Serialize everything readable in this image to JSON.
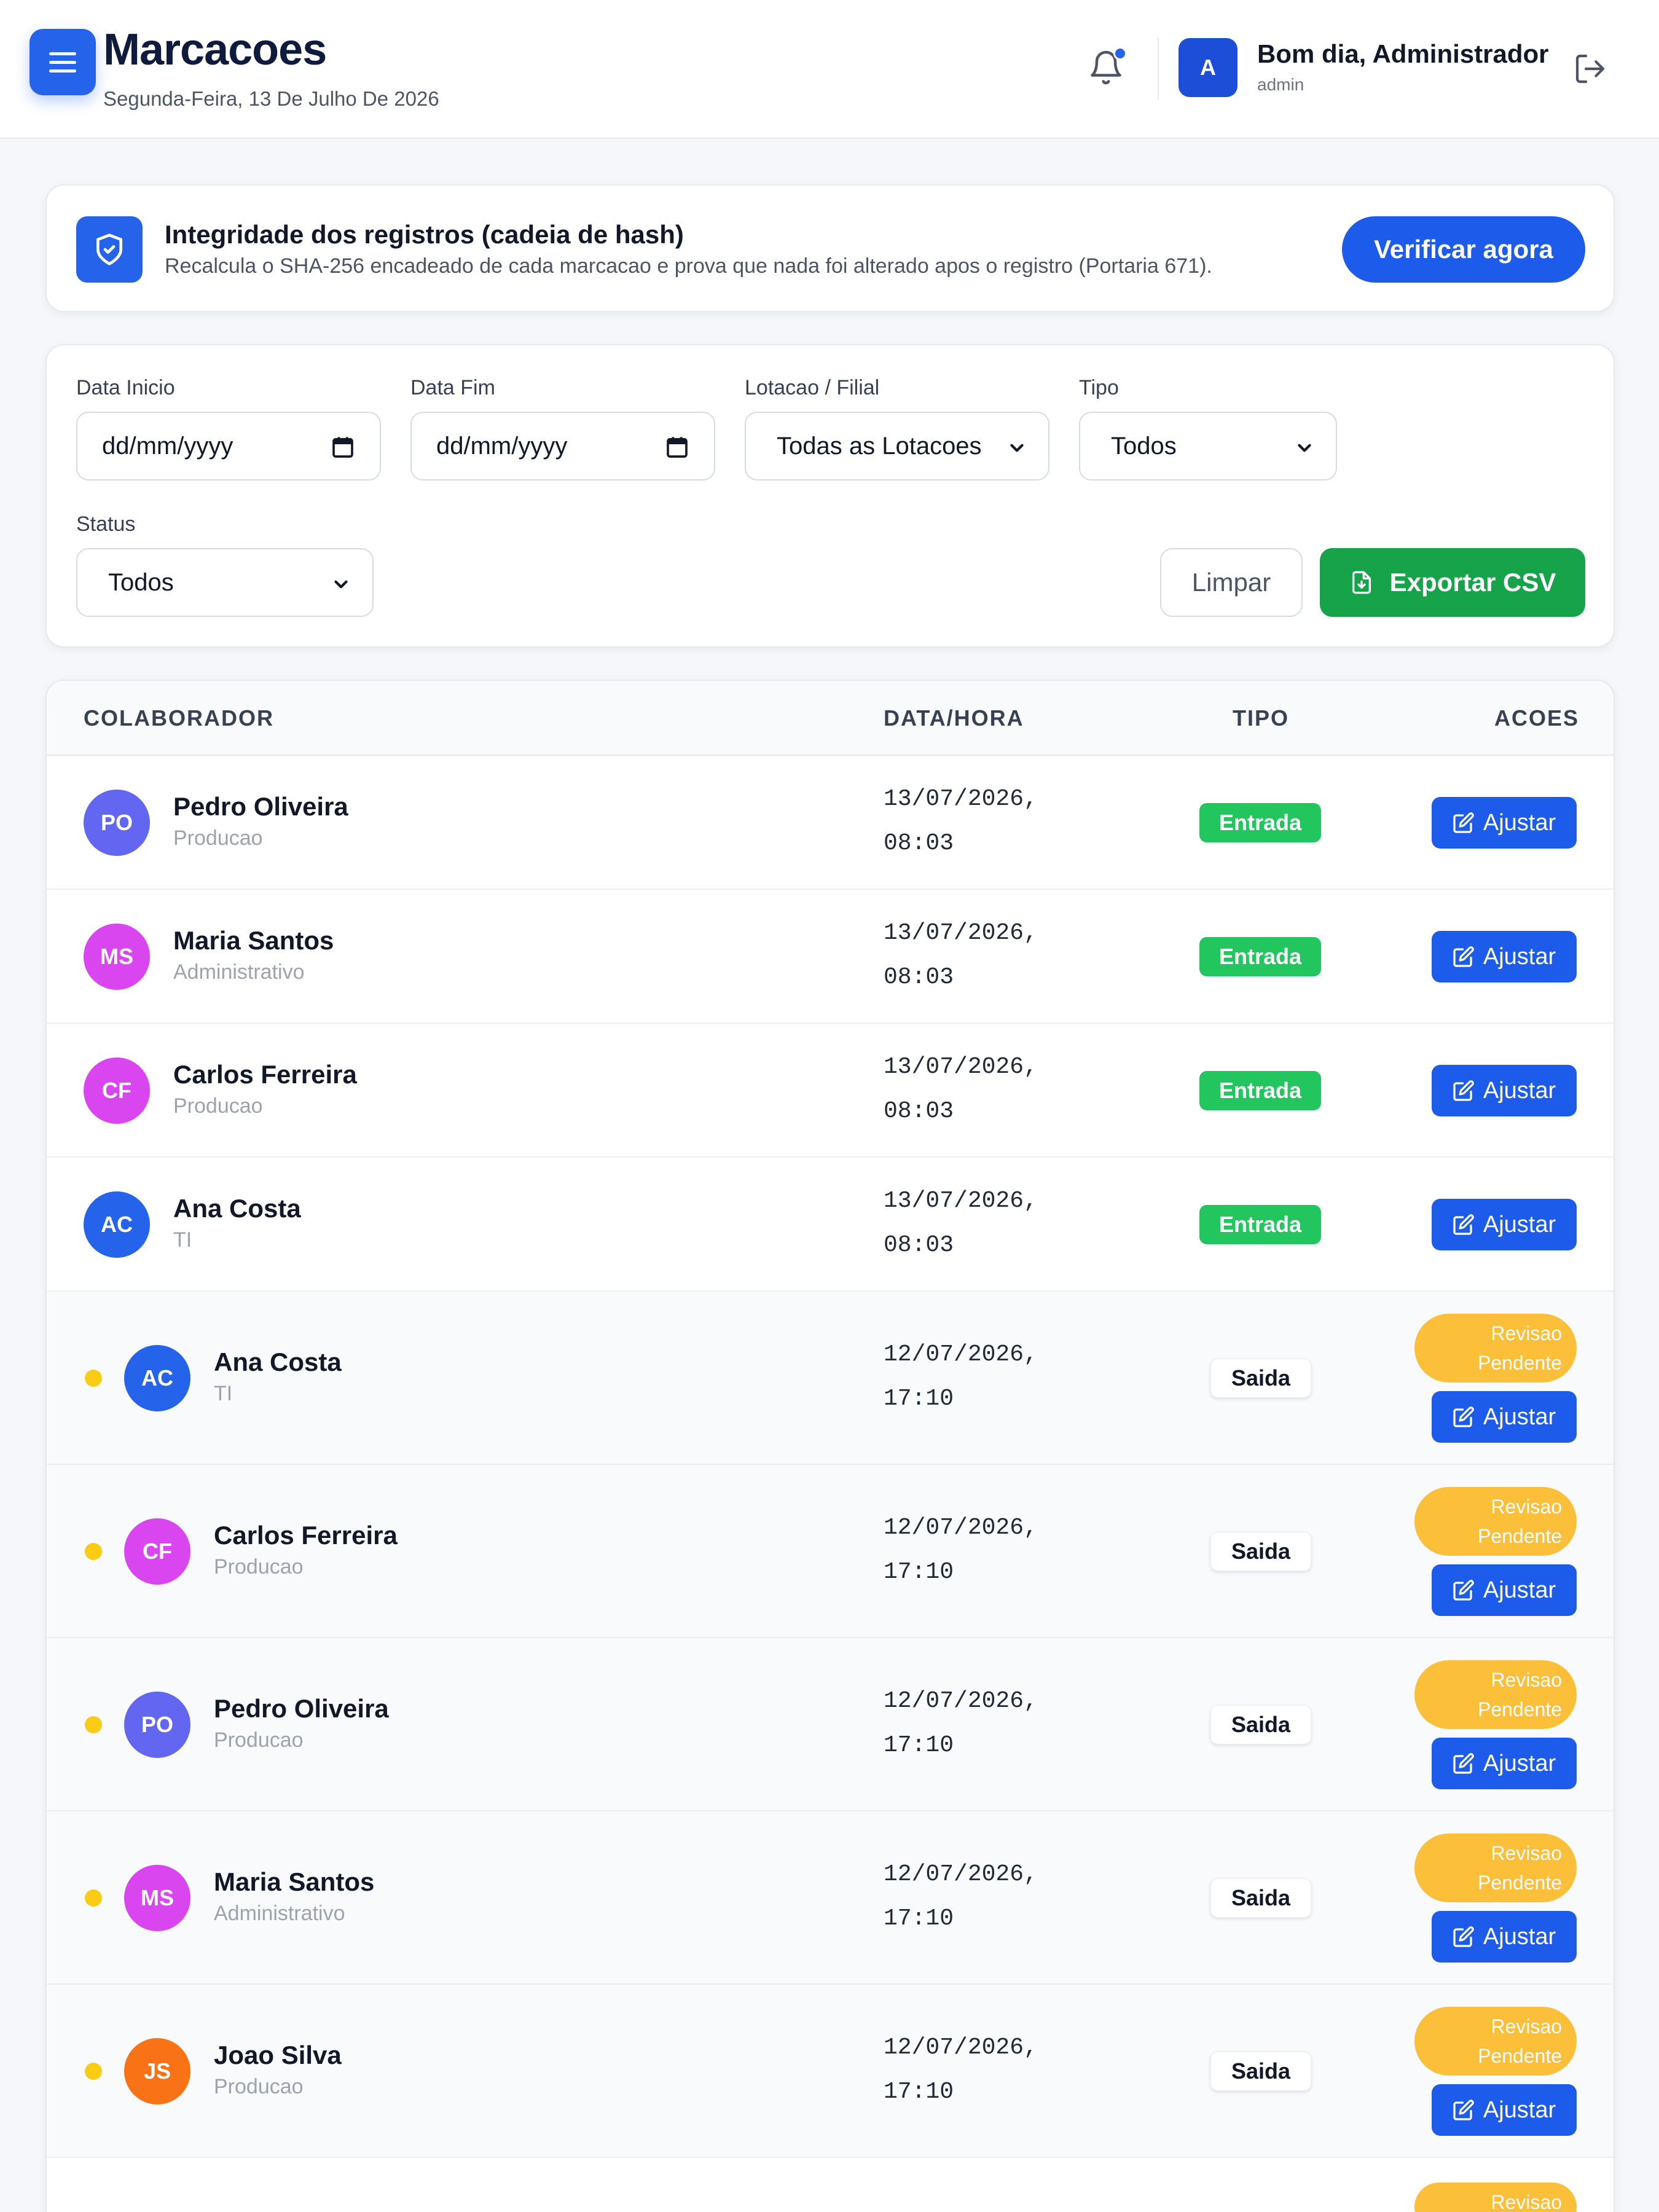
{
  "header": {
    "title": "Marcacoes",
    "date": "Segunda-Feira, 13 De Julho De 2026",
    "greeting": "Bom dia, Administrador",
    "username": "admin",
    "avatar_initial": "A"
  },
  "integrity": {
    "title": "Integridade dos registros (cadeia de hash)",
    "description": "Recalcula o SHA-256 encadeado de cada marcacao e prova que nada foi alterado apos o registro (Portaria 671).",
    "verify_label": "Verificar agora"
  },
  "filters": {
    "start_label": "Data Inicio",
    "start_placeholder": "dd/mm/yyyy",
    "end_label": "Data Fim",
    "end_placeholder": "dd/mm/yyyy",
    "location_label": "Lotacao / Filial",
    "location_value": "Todas as Lotacoes",
    "type_label": "Tipo",
    "type_value": "Todos",
    "status_label": "Status",
    "status_value": "Todos",
    "clear_label": "Limpar",
    "export_label": "Exportar CSV"
  },
  "table": {
    "headers": {
      "collaborator": "COLABORADOR",
      "datetime": "DATA/HORA",
      "type": "TIPO",
      "actions": "ACOES"
    },
    "adjust_label": "Ajustar",
    "pending_label_1": "Revisao",
    "pending_label_2": "Pendente",
    "rows": [
      {
        "initials": "PO",
        "name": "Pedro Oliveira",
        "dept": "Producao",
        "date": "13/07/2026,",
        "time": "08:03",
        "type": "Entrada",
        "pending": false,
        "color": "#6366f1"
      },
      {
        "initials": "MS",
        "name": "Maria Santos",
        "dept": "Administrativo",
        "date": "13/07/2026,",
        "time": "08:03",
        "type": "Entrada",
        "pending": false,
        "color": "#d946ef"
      },
      {
        "initials": "CF",
        "name": "Carlos Ferreira",
        "dept": "Producao",
        "date": "13/07/2026,",
        "time": "08:03",
        "type": "Entrada",
        "pending": false,
        "color": "#d946ef"
      },
      {
        "initials": "AC",
        "name": "Ana Costa",
        "dept": "TI",
        "date": "13/07/2026,",
        "time": "08:03",
        "type": "Entrada",
        "pending": false,
        "color": "#2563eb"
      },
      {
        "initials": "AC",
        "name": "Ana Costa",
        "dept": "TI",
        "date": "12/07/2026,",
        "time": "17:10",
        "type": "Saida",
        "pending": true,
        "color": "#2563eb"
      },
      {
        "initials": "CF",
        "name": "Carlos Ferreira",
        "dept": "Producao",
        "date": "12/07/2026,",
        "time": "17:10",
        "type": "Saida",
        "pending": true,
        "color": "#d946ef"
      },
      {
        "initials": "PO",
        "name": "Pedro Oliveira",
        "dept": "Producao",
        "date": "12/07/2026,",
        "time": "17:10",
        "type": "Saida",
        "pending": true,
        "color": "#6366f1"
      },
      {
        "initials": "MS",
        "name": "Maria Santos",
        "dept": "Administrativo",
        "date": "12/07/2026,",
        "time": "17:10",
        "type": "Saida",
        "pending": true,
        "color": "#d946ef"
      },
      {
        "initials": "JS",
        "name": "Joao Silva",
        "dept": "Producao",
        "date": "12/07/2026,",
        "time": "17:10",
        "type": "Saida",
        "pending": true,
        "color": "#f97316"
      }
    ],
    "partial_row": {
      "pending_label": "Revisao"
    }
  }
}
